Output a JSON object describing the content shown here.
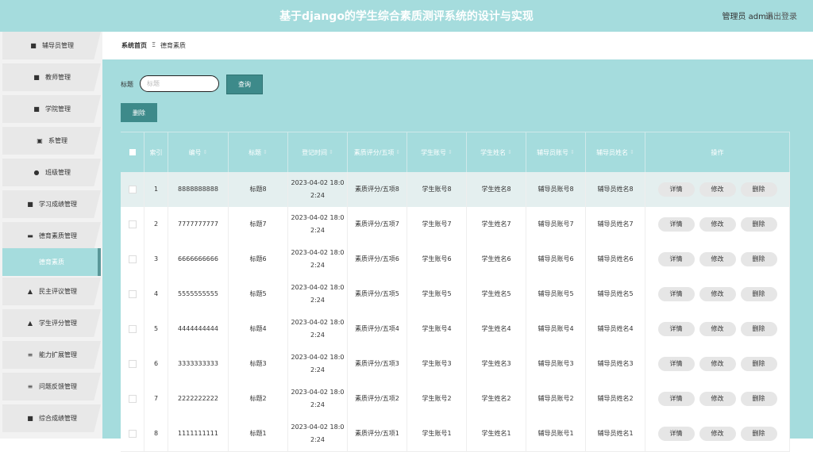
{
  "header": {
    "title": "基于django的学生综合素质测评系统的设计与实现",
    "user": "管理员 admin",
    "logout": "退出登录"
  },
  "sidebar": {
    "items": [
      {
        "label": "辅导员管理",
        "icon": "grid-icon"
      },
      {
        "label": "教师管理",
        "icon": "grid-icon"
      },
      {
        "label": "学院管理",
        "icon": "grid-icon"
      },
      {
        "label": "系管理",
        "icon": "clipboard-icon"
      },
      {
        "label": "班级管理",
        "icon": "location-icon"
      },
      {
        "label": "学习成绩管理",
        "icon": "grid-icon"
      },
      {
        "label": "德育素质管理",
        "icon": "chat-icon"
      },
      {
        "label": "德育素质",
        "icon": ""
      },
      {
        "label": "民主评议管理",
        "icon": "person-icon"
      },
      {
        "label": "学生评分管理",
        "icon": "person-icon"
      },
      {
        "label": "能力扩展管理",
        "icon": "list-icon"
      },
      {
        "label": "问题反馈管理",
        "icon": "list-icon"
      },
      {
        "label": "综合成绩管理",
        "icon": "grid-icon"
      }
    ]
  },
  "breadcrumb": {
    "home": "系统首页",
    "sep": "Ξ",
    "current": "德育素质"
  },
  "search": {
    "label": "标题",
    "placeholder": "标题",
    "button": "查询"
  },
  "actions": {
    "delete": "删除"
  },
  "table": {
    "headers": [
      "索引",
      "编号",
      "标题",
      "登记时间",
      "素质评分/五项",
      "学生账号",
      "学生姓名",
      "辅导员账号",
      "辅导员姓名",
      "操作"
    ],
    "row_ops": [
      "详情",
      "修改",
      "删除"
    ],
    "rows": [
      {
        "index": "1",
        "code": "8888888888",
        "title": "标题8",
        "time1": "2023-04-02 18:0",
        "time2": "2:24",
        "score": "素质评分/五项8",
        "sacc": "学生账号8",
        "sname": "学生姓名8",
        "cacc": "辅导员账号8",
        "cname": "辅导员姓名8"
      },
      {
        "index": "2",
        "code": "7777777777",
        "title": "标题7",
        "time1": "2023-04-02 18:0",
        "time2": "2:24",
        "score": "素质评分/五项7",
        "sacc": "学生账号7",
        "sname": "学生姓名7",
        "cacc": "辅导员账号7",
        "cname": "辅导员姓名7"
      },
      {
        "index": "3",
        "code": "6666666666",
        "title": "标题6",
        "time1": "2023-04-02 18:0",
        "time2": "2:24",
        "score": "素质评分/五项6",
        "sacc": "学生账号6",
        "sname": "学生姓名6",
        "cacc": "辅导员账号6",
        "cname": "辅导员姓名6"
      },
      {
        "index": "4",
        "code": "5555555555",
        "title": "标题5",
        "time1": "2023-04-02 18:0",
        "time2": "2:24",
        "score": "素质评分/五项5",
        "sacc": "学生账号5",
        "sname": "学生姓名5",
        "cacc": "辅导员账号5",
        "cname": "辅导员姓名5"
      },
      {
        "index": "5",
        "code": "4444444444",
        "title": "标题4",
        "time1": "2023-04-02 18:0",
        "time2": "2:24",
        "score": "素质评分/五项4",
        "sacc": "学生账号4",
        "sname": "学生姓名4",
        "cacc": "辅导员账号4",
        "cname": "辅导员姓名4"
      },
      {
        "index": "6",
        "code": "3333333333",
        "title": "标题3",
        "time1": "2023-04-02 18:0",
        "time2": "2:24",
        "score": "素质评分/五项3",
        "sacc": "学生账号3",
        "sname": "学生姓名3",
        "cacc": "辅导员账号3",
        "cname": "辅导员姓名3"
      },
      {
        "index": "7",
        "code": "2222222222",
        "title": "标题2",
        "time1": "2023-04-02 18:0",
        "time2": "2:24",
        "score": "素质评分/五项2",
        "sacc": "学生账号2",
        "sname": "学生姓名2",
        "cacc": "辅导员账号2",
        "cname": "辅导员姓名2"
      },
      {
        "index": "8",
        "code": "1111111111",
        "title": "标题1",
        "time1": "2023-04-02 18:0",
        "time2": "2:24",
        "score": "素质评分/五项1",
        "sacc": "学生账号1",
        "sname": "学生姓名1",
        "cacc": "辅导员账号1",
        "cname": "辅导员姓名1"
      }
    ]
  },
  "colors": {
    "accent": "#a5dcdd",
    "accent_dark": "#3d8a8a"
  }
}
